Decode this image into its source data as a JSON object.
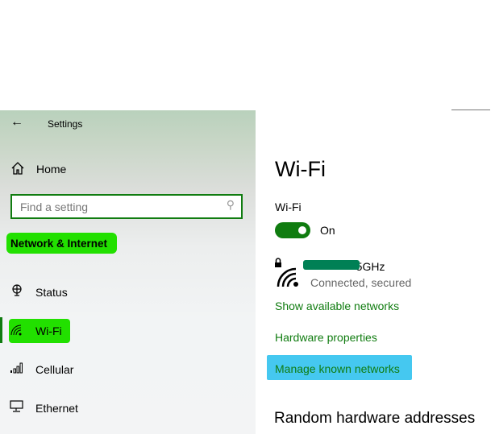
{
  "window": {
    "title": "Settings"
  },
  "sidebar": {
    "home": "Home",
    "search_placeholder": "Find a setting",
    "section": "Network & Internet",
    "items": [
      {
        "label": "Status",
        "icon": "globe-monitor-icon"
      },
      {
        "label": "Wi-Fi",
        "icon": "wifi-icon",
        "selected": true
      },
      {
        "label": "Cellular",
        "icon": "signal-bars-icon"
      },
      {
        "label": "Ethernet",
        "icon": "ethernet-icon"
      }
    ]
  },
  "main": {
    "title": "Wi-Fi",
    "wifi_label": "Wi-Fi",
    "toggle_state": "On",
    "network": {
      "name": "-5GHz",
      "status": "Connected, secured"
    },
    "links": [
      "Show available networks",
      "Hardware properties",
      "Manage known networks"
    ],
    "section": "Random hardware addresses"
  },
  "colors": {
    "accent": "#107c10",
    "highlight_green": "#22e000",
    "highlight_blue": "#45c8f0",
    "redaction": "#008055"
  }
}
